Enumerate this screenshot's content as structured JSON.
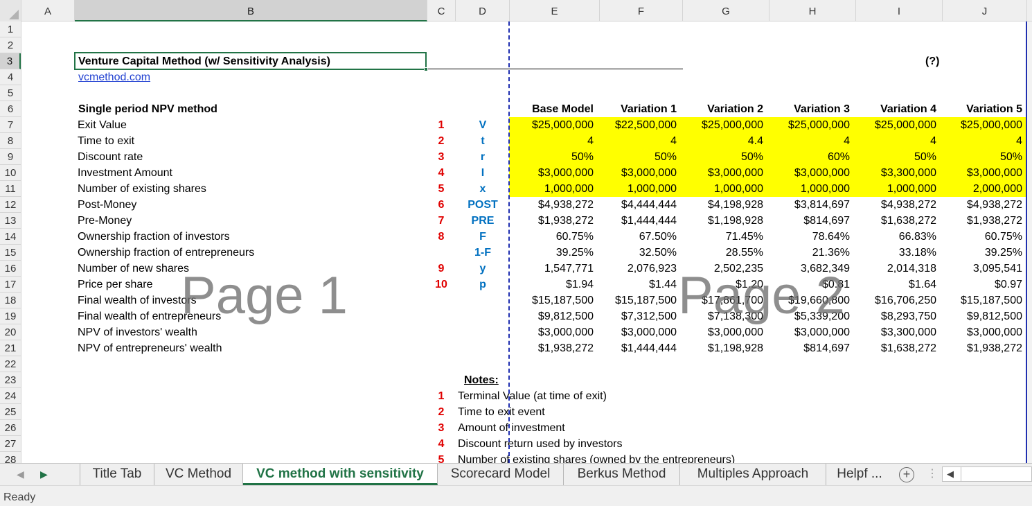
{
  "columns": [
    "A",
    "B",
    "C",
    "D",
    "E",
    "F",
    "G",
    "H",
    "I",
    "J"
  ],
  "selected_column": "B",
  "selected_row": "3",
  "rows": [
    "1",
    "2",
    "3",
    "4",
    "5",
    "6",
    "7",
    "8",
    "9",
    "10",
    "11",
    "12",
    "13",
    "14",
    "15",
    "16",
    "17",
    "18",
    "19",
    "20",
    "21",
    "22",
    "23",
    "24",
    "25",
    "26",
    "27",
    "28"
  ],
  "sheet": {
    "title": "Venture Capital Method (w/ Sensitivity Analysis)",
    "link": "vcmethod.com",
    "help_marker": "(?)",
    "section_title": "Single period NPV method",
    "headers": [
      "Base Model",
      "Variation 1",
      "Variation 2",
      "Variation 3",
      "Variation 4",
      "Variation 5"
    ],
    "table_rows": [
      {
        "label": "Exit Value",
        "num": "1",
        "sym": "V",
        "values": [
          "$25,000,000",
          "$22,500,000",
          "$25,000,000",
          "$25,000,000",
          "$25,000,000",
          "$25,000,000"
        ]
      },
      {
        "label": "Time to exit",
        "num": "2",
        "sym": "t",
        "values": [
          "4",
          "4",
          "4.4",
          "4",
          "4",
          "4"
        ]
      },
      {
        "label": "Discount rate",
        "num": "3",
        "sym": "r",
        "values": [
          "50%",
          "50%",
          "50%",
          "60%",
          "50%",
          "50%"
        ]
      },
      {
        "label": "Investment Amount",
        "num": "4",
        "sym": "I",
        "values": [
          "$3,000,000",
          "$3,000,000",
          "$3,000,000",
          "$3,000,000",
          "$3,300,000",
          "$3,000,000"
        ]
      },
      {
        "label": "Number of existing shares",
        "num": "5",
        "sym": "x",
        "values": [
          "1,000,000",
          "1,000,000",
          "1,000,000",
          "1,000,000",
          "1,000,000",
          "2,000,000"
        ]
      },
      {
        "label": "Post-Money",
        "num": "6",
        "sym": "POST",
        "values": [
          "$4,938,272",
          "$4,444,444",
          "$4,198,928",
          "$3,814,697",
          "$4,938,272",
          "$4,938,272"
        ]
      },
      {
        "label": "Pre-Money",
        "num": "7",
        "sym": "PRE",
        "values": [
          "$1,938,272",
          "$1,444,444",
          "$1,198,928",
          "$814,697",
          "$1,638,272",
          "$1,938,272"
        ]
      },
      {
        "label": "Ownership fraction of investors",
        "num": "8",
        "sym": "F",
        "values": [
          "60.75%",
          "67.50%",
          "71.45%",
          "78.64%",
          "66.83%",
          "60.75%"
        ]
      },
      {
        "label": "Ownership fraction of entrepreneurs",
        "num": "",
        "sym": "1-F",
        "values": [
          "39.25%",
          "32.50%",
          "28.55%",
          "21.36%",
          "33.18%",
          "39.25%"
        ]
      },
      {
        "label": "Number of new shares",
        "num": "9",
        "sym": "y",
        "values": [
          "1,547,771",
          "2,076,923",
          "2,502,235",
          "3,682,349",
          "2,014,318",
          "3,095,541"
        ]
      },
      {
        "label": "Price per share",
        "num": "10",
        "sym": "p",
        "values": [
          "$1.94",
          "$1.44",
          "$1.20",
          "$0.81",
          "$1.64",
          "$0.97"
        ]
      },
      {
        "label": "Final wealth of investors",
        "num": "",
        "sym": "",
        "values": [
          "$15,187,500",
          "$15,187,500",
          "$17,861,700",
          "$19,660,800",
          "$16,706,250",
          "$15,187,500"
        ]
      },
      {
        "label": "Final wealth of entrepreneurs",
        "num": "",
        "sym": "",
        "values": [
          "$9,812,500",
          "$7,312,500",
          "$7,138,300",
          "$5,339,200",
          "$8,293,750",
          "$9,812,500"
        ]
      },
      {
        "label": "NPV of investors' wealth",
        "num": "",
        "sym": "",
        "values": [
          "$3,000,000",
          "$3,000,000",
          "$3,000,000",
          "$3,000,000",
          "$3,300,000",
          "$3,000,000"
        ]
      },
      {
        "label": "NPV of entrepreneurs' wealth",
        "num": "",
        "sym": "",
        "values": [
          "$1,938,272",
          "$1,444,444",
          "$1,198,928",
          "$814,697",
          "$1,638,272",
          "$1,938,272"
        ]
      }
    ],
    "notes_title": "Notes:",
    "notes": [
      {
        "num": "1",
        "text": "Terminal Value (at time of exit)"
      },
      {
        "num": "2",
        "text": "Time to exit event"
      },
      {
        "num": "3",
        "text": "Amount of investment"
      },
      {
        "num": "4",
        "text": "Discount return used by investors"
      },
      {
        "num": "5",
        "text": "Number of existing shares (owned by the entrepreneurs)"
      }
    ],
    "watermarks": [
      "Page 1",
      "Page 2"
    ]
  },
  "tabs": [
    "Title Tab",
    "VC Method",
    "VC method with sensitivity",
    "Scorecard Model",
    "Berkus Method",
    "Multiples Approach",
    "Helpf ..."
  ],
  "active_tab": "VC method with sensitivity",
  "add_sheet_label": "+",
  "more_label": "⋮",
  "nav_prev": "◀",
  "nav_next": "▶",
  "scroll_left": "◀",
  "status": "Ready",
  "colors": {
    "accent": "#217346",
    "highlight": "#ffff00",
    "number_red": "#e00000",
    "symbol_blue": "#0070c0",
    "page_break": "#1f2fb0"
  }
}
